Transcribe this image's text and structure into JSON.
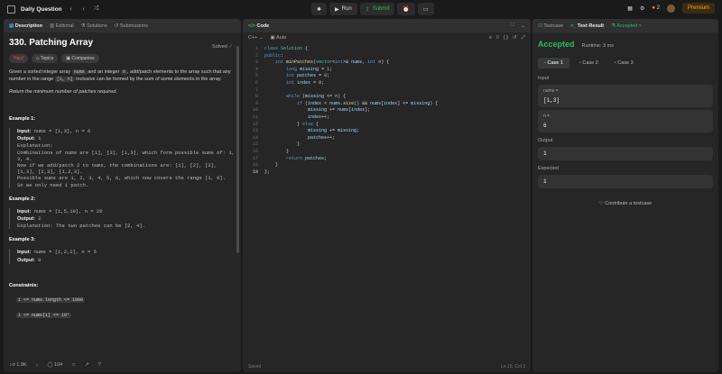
{
  "topbar": {
    "title": "Daily Question",
    "run_label": "Run",
    "submit_label": "Submit",
    "streak": "2",
    "premium_label": "Premium"
  },
  "desc_tabs": [
    "Description",
    "Editorial",
    "Solutions",
    "Submissions"
  ],
  "problem": {
    "title": "330. Patching Array",
    "solved": "Solved",
    "difficulty": "Hard",
    "tag_topics": "Topics",
    "tag_companies": "Companies",
    "para1_a": "Given a sorted integer array ",
    "para1_code1": "nums",
    "para1_b": " and an integer ",
    "para1_code2": "n",
    "para1_c": ", add/patch elements to the array such that any number in the range ",
    "para1_code3": "[1, n]",
    "para1_d": " inclusive can be formed by the sum of some elements in the array.",
    "para2": "Return the minimum number of patches required.",
    "examples": [
      {
        "title": "Example 1:",
        "input": "nums = [1,3], n = 6",
        "output": "1",
        "explanation": "Explanation:\nCombinations of nums are [1], [3], [1,3], which form possible sums of: 1, 3, 4.\nNow if we add/patch 2 to nums, the combinations are: [1], [2], [3], [1,3], [2,3], [1,2,3].\nPossible sums are 1, 2, 3, 4, 5, 6, which now covers the range [1, 6].\nSo we only need 1 patch."
      },
      {
        "title": "Example 2:",
        "input": "nums = [1,5,10], n = 20",
        "output": "2",
        "explanation": "Explanation: The two patches can be [2, 4]."
      },
      {
        "title": "Example 3:",
        "input": "nums = [1,2,2], n = 5",
        "output": "0",
        "explanation": ""
      }
    ],
    "input_label": "Input:",
    "output_label": "Output:",
    "constraints_title": "Constraints:",
    "constraints": [
      "1 <= nums.length <= 1000",
      "1 <= nums[i] <= 10⁴"
    ]
  },
  "desc_footer": {
    "likes": "1.9K",
    "comments": "104"
  },
  "code": {
    "tab_label": "Code",
    "language": "C++",
    "auto": "Auto",
    "status": "Saved",
    "cursor": "Ln 19, Col 3",
    "lines": [
      "class Solution {",
      "public:",
      "    int minPatches(vector<int>& nums, int n) {",
      "        long missing = 1;",
      "        int patches = 0;",
      "        int index = 0;",
      "",
      "        while (missing <= n) {",
      "            if (index < nums.size() && nums[index] <= missing) {",
      "                missing += nums[index];",
      "                index++;",
      "            } else {",
      "                missing += missing;",
      "                patches++;",
      "            }",
      "        }",
      "        return patches;",
      "    }",
      "};"
    ]
  },
  "result": {
    "tabs": [
      "Testcase",
      "Test Result",
      "Accepted"
    ],
    "title": "Accepted",
    "runtime": "Runtime: 3 ms",
    "cases": [
      "Case 1",
      "Case 2",
      "Case 3"
    ],
    "input_label": "Input",
    "var1_name": "nums =",
    "var1_value": "[1,3]",
    "var2_name": "n =",
    "var2_value": "6",
    "output_label": "Output",
    "output_value": "1",
    "expected_label": "Expected",
    "expected_value": "1",
    "contribute": "Contribute a testcase"
  }
}
